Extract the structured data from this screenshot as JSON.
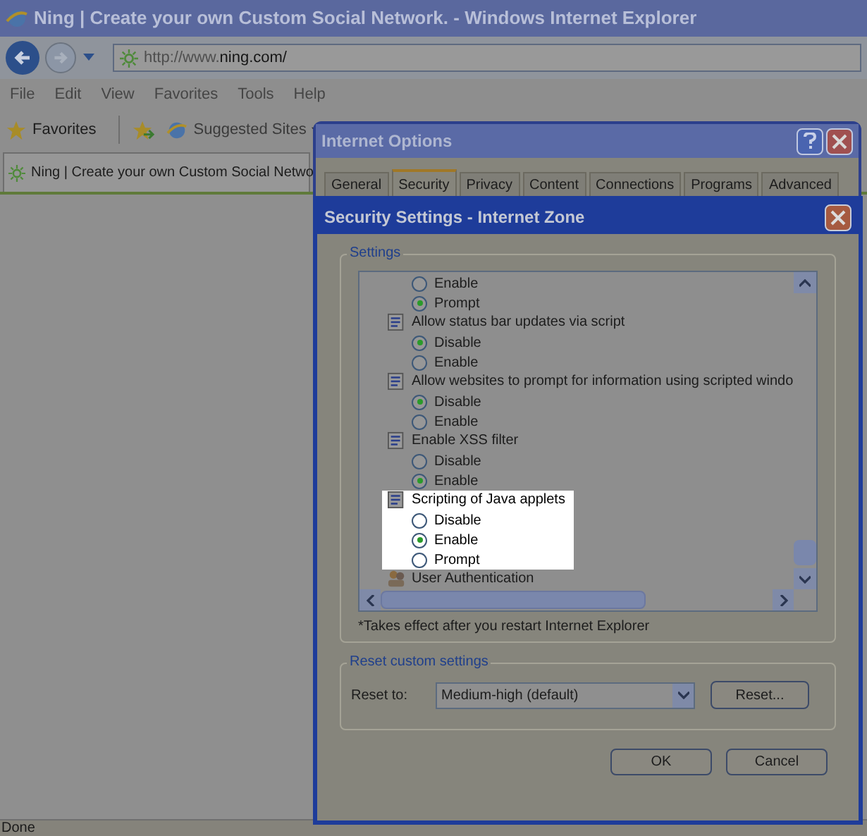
{
  "browser": {
    "title": "Ning | Create your own Custom Social Network. - Windows Internet Explorer",
    "address": {
      "prefix": "http://www.",
      "domain": "ning.com/"
    },
    "menu": [
      "File",
      "Edit",
      "View",
      "Favorites",
      "Tools",
      "Help"
    ],
    "favorites_label": "Favorites",
    "suggested_sites": "Suggested Sites",
    "tab_title": "Ning | Create your own Custom Social Netwo",
    "status": "Done"
  },
  "internet_options": {
    "title": "Internet Options",
    "tabs": [
      {
        "label": "General",
        "selected": false
      },
      {
        "label": "Security",
        "selected": true
      },
      {
        "label": "Privacy",
        "selected": false
      },
      {
        "label": "Content",
        "selected": false
      },
      {
        "label": "Connections",
        "selected": false
      },
      {
        "label": "Programs",
        "selected": false
      },
      {
        "label": "Advanced",
        "selected": false
      }
    ]
  },
  "security_settings": {
    "title": "Security Settings - Internet Zone",
    "settings_label": "Settings",
    "groups": [
      {
        "highlighted": false,
        "options": [
          {
            "label": "Enable",
            "selected": false
          },
          {
            "label": "Prompt",
            "selected": true
          }
        ]
      },
      {
        "kind": "script",
        "label": "Allow status bar updates via script",
        "highlighted": false,
        "options": [
          {
            "label": "Disable",
            "selected": true
          },
          {
            "label": "Enable",
            "selected": false
          }
        ]
      },
      {
        "kind": "script",
        "label": "Allow websites to prompt for information using scripted windo",
        "highlighted": false,
        "options": [
          {
            "label": "Disable",
            "selected": true
          },
          {
            "label": "Enable",
            "selected": false
          }
        ]
      },
      {
        "kind": "script",
        "label": "Enable XSS filter",
        "highlighted": false,
        "options": [
          {
            "label": "Disable",
            "selected": false
          },
          {
            "label": "Enable",
            "selected": true
          }
        ]
      },
      {
        "kind": "script",
        "label": "Scripting of Java applets",
        "highlighted": true,
        "options": [
          {
            "label": "Disable",
            "selected": false
          },
          {
            "label": "Enable",
            "selected": true
          },
          {
            "label": "Prompt",
            "selected": false
          }
        ]
      },
      {
        "kind": "users",
        "label": "User Authentication",
        "highlighted": false
      }
    ],
    "note": "*Takes effect after you restart Internet Explorer",
    "reset_group": "Reset custom settings",
    "reset_label": "Reset to:",
    "reset_value": "Medium-high (default)",
    "reset_button": "Reset...",
    "buttons": [
      "OK",
      "Cancel"
    ]
  }
}
